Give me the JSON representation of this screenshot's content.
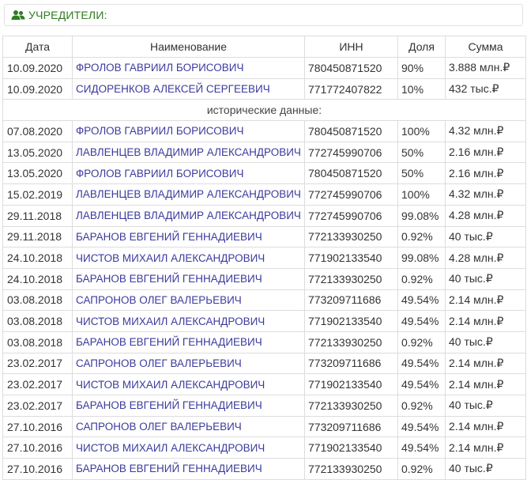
{
  "section": {
    "title": "УЧРЕДИТЕЛИ:",
    "icon": "users-icon",
    "title_color": "#2e7d1f"
  },
  "table": {
    "headers": {
      "date": "Дата",
      "name": "Наименование",
      "inn": "ИНН",
      "share": "Доля",
      "sum": "Сумма"
    },
    "current": [
      {
        "date": "10.09.2020",
        "name": "ФРОЛОВ ГАВРИИЛ БОРИСОВИЧ",
        "inn": "780450871520",
        "share": "90%",
        "sum": "3.888 млн.₽"
      },
      {
        "date": "10.09.2020",
        "name": "СИДОРЕНКОВ АЛЕКСЕЙ СЕРГЕЕВИЧ",
        "inn": "771772407822",
        "share": "10%",
        "sum": "432 тыс.₽"
      }
    ],
    "history_label": "исторические данные:",
    "history": [
      {
        "date": "07.08.2020",
        "name": "ФРОЛОВ ГАВРИИЛ БОРИСОВИЧ",
        "inn": "780450871520",
        "share": "100%",
        "sum": "4.32 млн.₽"
      },
      {
        "date": "13.05.2020",
        "name": "ЛАВЛЕНЦЕВ ВЛАДИМИР АЛЕКСАНДРОВИЧ",
        "inn": "772745990706",
        "share": "50%",
        "sum": "2.16 млн.₽"
      },
      {
        "date": "13.05.2020",
        "name": "ФРОЛОВ ГАВРИИЛ БОРИСОВИЧ",
        "inn": "780450871520",
        "share": "50%",
        "sum": "2.16 млн.₽"
      },
      {
        "date": "15.02.2019",
        "name": "ЛАВЛЕНЦЕВ ВЛАДИМИР АЛЕКСАНДРОВИЧ",
        "inn": "772745990706",
        "share": "100%",
        "sum": "4.32 млн.₽"
      },
      {
        "date": "29.11.2018",
        "name": "ЛАВЛЕНЦЕВ ВЛАДИМИР АЛЕКСАНДРОВИЧ",
        "inn": "772745990706",
        "share": "99.08%",
        "sum": "4.28 млн.₽"
      },
      {
        "date": "29.11.2018",
        "name": "БАРАНОВ ЕВГЕНИЙ ГЕННАДИЕВИЧ",
        "inn": "772133930250",
        "share": "0.92%",
        "sum": "40 тыс.₽"
      },
      {
        "date": "24.10.2018",
        "name": "ЧИСТОВ МИХАИЛ АЛЕКСАНДРОВИЧ",
        "inn": "771902133540",
        "share": "99.08%",
        "sum": "4.28 млн.₽"
      },
      {
        "date": "24.10.2018",
        "name": "БАРАНОВ ЕВГЕНИЙ ГЕННАДИЕВИЧ",
        "inn": "772133930250",
        "share": "0.92%",
        "sum": "40 тыс.₽"
      },
      {
        "date": "03.08.2018",
        "name": "САПРОНОВ ОЛЕГ ВАЛЕРЬЕВИЧ",
        "inn": "773209711686",
        "share": "49.54%",
        "sum": "2.14 млн.₽"
      },
      {
        "date": "03.08.2018",
        "name": "ЧИСТОВ МИХАИЛ АЛЕКСАНДРОВИЧ",
        "inn": "771902133540",
        "share": "49.54%",
        "sum": "2.14 млн.₽"
      },
      {
        "date": "03.08.2018",
        "name": "БАРАНОВ ЕВГЕНИЙ ГЕННАДИЕВИЧ",
        "inn": "772133930250",
        "share": "0.92%",
        "sum": "40 тыс.₽"
      },
      {
        "date": "23.02.2017",
        "name": "САПРОНОВ ОЛЕГ ВАЛЕРЬЕВИЧ",
        "inn": "773209711686",
        "share": "49.54%",
        "sum": "2.14 млн.₽"
      },
      {
        "date": "23.02.2017",
        "name": "ЧИСТОВ МИХАИЛ АЛЕКСАНДРОВИЧ",
        "inn": "771902133540",
        "share": "49.54%",
        "sum": "2.14 млн.₽"
      },
      {
        "date": "23.02.2017",
        "name": "БАРАНОВ ЕВГЕНИЙ ГЕННАДИЕВИЧ",
        "inn": "772133930250",
        "share": "0.92%",
        "sum": "40 тыс.₽"
      },
      {
        "date": "27.10.2016",
        "name": "САПРОНОВ ОЛЕГ ВАЛЕРЬЕВИЧ",
        "inn": "773209711686",
        "share": "49.54%",
        "sum": "2.14 млн.₽"
      },
      {
        "date": "27.10.2016",
        "name": "ЧИСТОВ МИХАИЛ АЛЕКСАНДРОВИЧ",
        "inn": "771902133540",
        "share": "49.54%",
        "sum": "2.14 млн.₽"
      },
      {
        "date": "27.10.2016",
        "name": "БАРАНОВ ЕВГЕНИЙ ГЕННАДИЕВИЧ",
        "inn": "772133930250",
        "share": "0.92%",
        "sum": "40 тыс.₽"
      }
    ]
  }
}
